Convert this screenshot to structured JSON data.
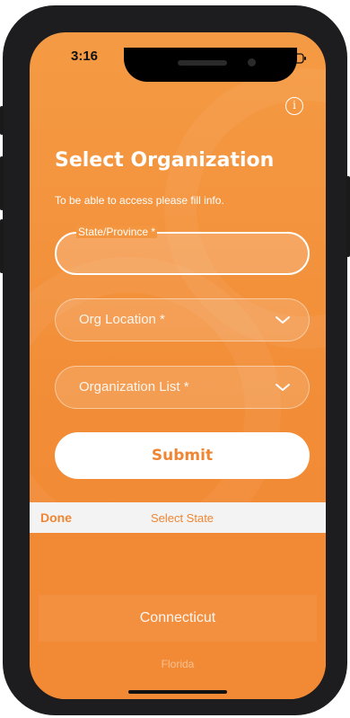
{
  "status_bar": {
    "time": "3:16"
  },
  "header": {
    "title": "Select Organization",
    "subtitle": "To be able to access please fill info."
  },
  "form": {
    "state_label": "State/Province *",
    "state_value": "",
    "org_location_label": "Org Location *",
    "organization_list_label": "Organization List *",
    "submit_label": "Submit"
  },
  "picker": {
    "done_label": "Done",
    "title": "Select State",
    "options": [
      "Connecticut",
      "Florida"
    ],
    "selected": "Connecticut"
  },
  "icons": {
    "info": "info-icon",
    "chevron": "chevron-down-icon",
    "signal": "signal-icon",
    "wifi": "wifi-icon",
    "battery": "battery-icon"
  },
  "colors": {
    "accent": "#f08633",
    "background": "#f39442",
    "toolbar": "#f3f3f3"
  }
}
